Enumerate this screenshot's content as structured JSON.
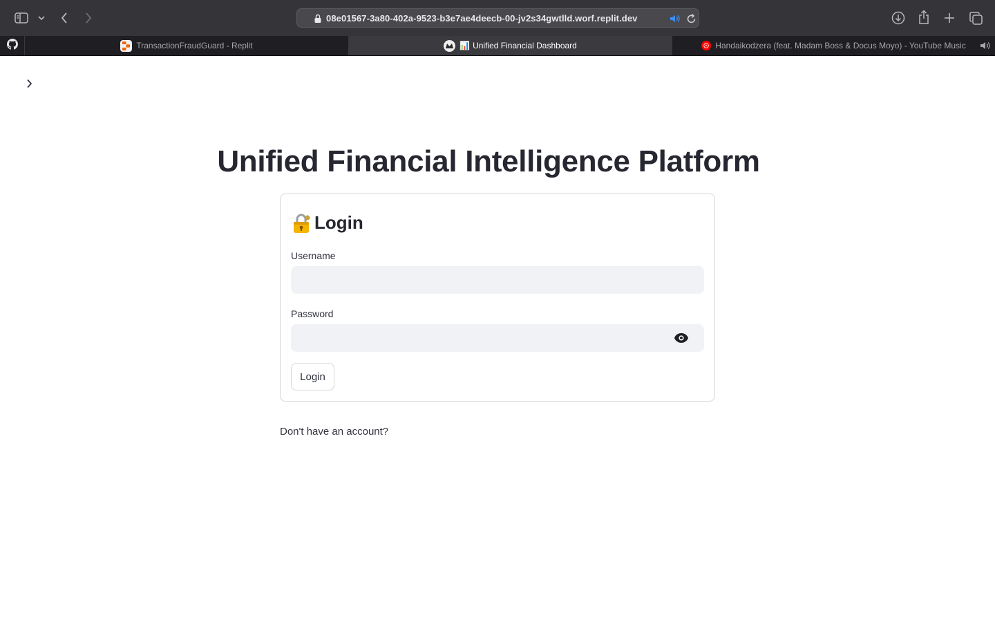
{
  "browser": {
    "url": "08e01567-3a80-402a-9523-b3e7ae4deecb-00-jv2s34gwtlld.worf.replit.dev",
    "tabs": [
      {
        "title": "TransactionFraudGuard - Replit",
        "favicon": "replit-icon",
        "active": false
      },
      {
        "emoji": "📊",
        "title": "Unified Financial Dashboard",
        "favicon": "streamlit-icon",
        "active": true
      },
      {
        "title": "Handaikodzera (feat. Madam Boss & Docus Moyo) - YouTube Music",
        "favicon": "youtube-music-icon",
        "active": false
      }
    ],
    "pinned_tab_icon": "github-icon"
  },
  "page": {
    "title": "Unified Financial Intelligence Platform",
    "login": {
      "heading": "Login",
      "heading_icon": "🔐",
      "username_label": "Username",
      "username_value": "",
      "password_label": "Password",
      "password_value": "",
      "submit_label": "Login"
    },
    "signup_prompt": "Don't have an account?"
  },
  "colors": {
    "text_dark": "#262730",
    "input_bg": "#f0f2f6",
    "border": "#d6d6d9",
    "chrome_bg": "#353438",
    "tabbar_bg": "#1f1e22",
    "active_tab_bg": "#3b3a3f"
  }
}
